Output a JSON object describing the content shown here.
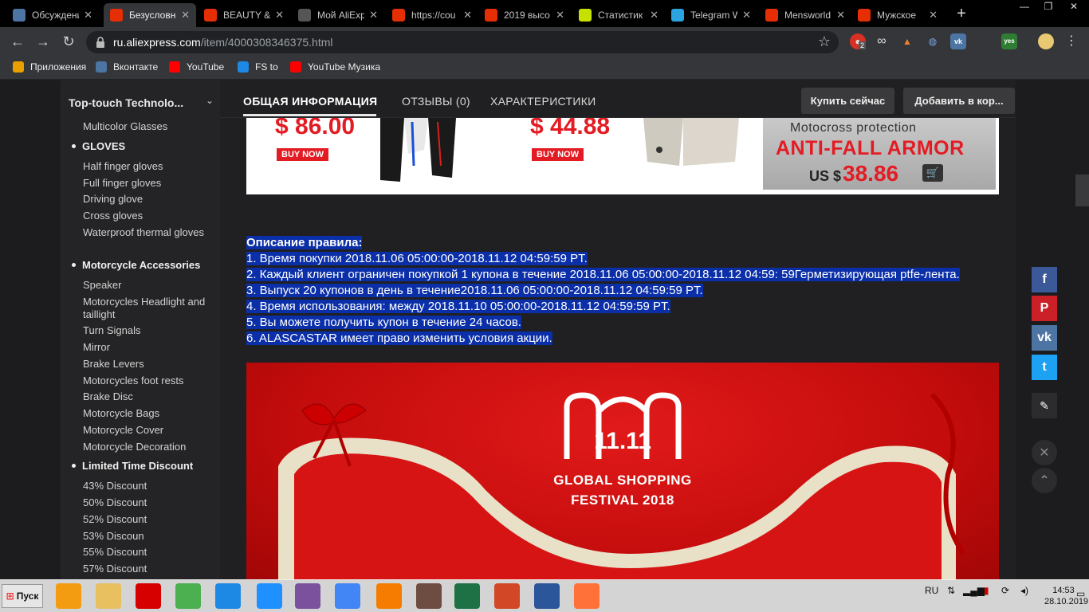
{
  "browser": {
    "tabs": [
      {
        "title": "Обсуждения",
        "icon": "vk-icon",
        "color": "#4c75a3"
      },
      {
        "title": "Безусловная",
        "icon": "aliexpress-icon",
        "color": "#e62e04",
        "active": true
      },
      {
        "title": "BEAUTY &",
        "icon": "aliexpress-icon",
        "color": "#e62e04"
      },
      {
        "title": "Мой AliExpress",
        "icon": "globe-icon",
        "color": "#555"
      },
      {
        "title": "https://cou",
        "icon": "aliexpress-icon",
        "color": "#e62e04"
      },
      {
        "title": "2019 высо",
        "icon": "aliexpress-icon",
        "color": "#e62e04"
      },
      {
        "title": "Статистик",
        "icon": "stats-icon",
        "color": "#c6e000"
      },
      {
        "title": "Telegram W",
        "icon": "telegram-icon",
        "color": "#2aa3e0"
      },
      {
        "title": "Mensworld",
        "icon": "aliexpress-icon",
        "color": "#e62e04"
      },
      {
        "title": "Мужское",
        "icon": "aliexpress-icon",
        "color": "#e62e04"
      }
    ],
    "url_host": "ru.aliexpress.com",
    "url_path": "/item/4000308346375.html",
    "ext_badge": "2",
    "ext_yes": "yes",
    "bookmarks": [
      {
        "label": "Приложения",
        "icon": "apps-icon",
        "color": "#e8a000"
      },
      {
        "label": "Вконтакте",
        "icon": "vk-icon",
        "color": "#4c75a3"
      },
      {
        "label": "YouTube",
        "icon": "youtube-icon",
        "color": "#ff0000"
      },
      {
        "label": "FS to",
        "icon": "fs-icon",
        "color": "#1e88e5"
      },
      {
        "label": "YouTube Музика",
        "icon": "youtube-music-icon",
        "color": "#ff0000"
      }
    ]
  },
  "sidebar": {
    "store_name": "Top-touch Technolo...",
    "items": [
      {
        "type": "item",
        "label": "Multicolor Glasses"
      },
      {
        "type": "cat",
        "label": "GLOVES"
      },
      {
        "type": "item",
        "label": "Half finger gloves"
      },
      {
        "type": "item",
        "label": "Full finger gloves"
      },
      {
        "type": "item",
        "label": "Driving glove"
      },
      {
        "type": "item",
        "label": "Cross gloves"
      },
      {
        "type": "item",
        "label": "Waterproof thermal gloves"
      },
      {
        "type": "cat",
        "label": "Motorcycle Accessories"
      },
      {
        "type": "item",
        "label": "Speaker"
      },
      {
        "type": "item",
        "label": "Motorcycles Headlight and taillight"
      },
      {
        "type": "item",
        "label": "Turn Signals"
      },
      {
        "type": "item",
        "label": "Mirror"
      },
      {
        "type": "item",
        "label": "Brake Levers"
      },
      {
        "type": "item",
        "label": "Motorcycles foot rests"
      },
      {
        "type": "item",
        "label": "Brake Disc"
      },
      {
        "type": "item",
        "label": "Motorcycle Bags"
      },
      {
        "type": "item",
        "label": "Motorcycle Cover"
      },
      {
        "type": "item",
        "label": "Motorcycle Decoration"
      },
      {
        "type": "cat",
        "label": "Limited Time Discount"
      },
      {
        "type": "item",
        "label": "43% Discount"
      },
      {
        "type": "item",
        "label": "50% Discount"
      },
      {
        "type": "item",
        "label": "52% Discount"
      },
      {
        "type": "item",
        "label": "53% Discoun"
      },
      {
        "type": "item",
        "label": "55% Discount"
      },
      {
        "type": "item",
        "label": "57% Discount"
      }
    ]
  },
  "product_tabs": {
    "overview": "ОБЩАЯ ИНФОРМАЦИЯ",
    "reviews": "ОТЗЫВЫ (0)",
    "specs": "ХАРАКТЕРИСТИКИ",
    "buy_now": "Купить сейчас",
    "add_to_cart": "Добавить в кор..."
  },
  "banner": {
    "price1": "$ 86.00",
    "price2": "$ 44.88",
    "buy_now": "BUY NOW",
    "protection_label": "Motocross protection",
    "armor_label": "ANTI-FALL ARMOR",
    "armor_price_prefix": "US $",
    "armor_price": "38.86"
  },
  "rules": {
    "title": "Описание правила:",
    "lines": [
      "1. Время покупки 2018.11.06 05:00:00-2018.11.12 04:59:59 PT.",
      "2. Каждый клиент ограничен покупкой 1 купона в течение 2018.11.06 05:00:00-2018.11.12 04:59: 59Герметизирующая ptfe-лента.",
      "3. Выпуск 20 купонов в день в течение2018.11.06 05:00:00-2018.11.12 04:59:59 PT.",
      "4. Время использования: между 2018.11.10 05:00:00-2018.11.12 04:59:59 PT.",
      "5. Вы можете получить купон в течение 24 часов.",
      "6. ALASCASTAR имеет право изменить условия акции."
    ]
  },
  "promo": {
    "logo_text": "11.11",
    "line1": "GLOBAL SHOPPING",
    "line2": "FESTIVAL 2018"
  },
  "share": [
    {
      "icon": "facebook-icon",
      "glyph": "f",
      "color": "#3b5998"
    },
    {
      "icon": "pinterest-icon",
      "glyph": "P",
      "color": "#cb2027"
    },
    {
      "icon": "vk-icon",
      "glyph": "vk",
      "color": "#4c75a3"
    },
    {
      "icon": "twitter-icon",
      "glyph": "t",
      "color": "#1da1f2"
    }
  ],
  "taskbar": {
    "start": "Пуск",
    "apps": [
      {
        "icon": "media-player-icon",
        "color": "#f39c12"
      },
      {
        "icon": "explorer-icon",
        "color": "#e8c060"
      },
      {
        "icon": "opera-icon",
        "color": "#d60000"
      },
      {
        "icon": "utorrent-icon",
        "color": "#4caf50"
      },
      {
        "icon": "paper-plane-icon",
        "color": "#1e88e5"
      },
      {
        "icon": "internet-explorer-icon",
        "color": "#1e90ff"
      },
      {
        "icon": "viber-icon",
        "color": "#7b519d"
      },
      {
        "icon": "chrome-icon",
        "color": "#4285f4"
      },
      {
        "icon": "ccleaner-icon",
        "color": "#f57c00"
      },
      {
        "icon": "game-icon",
        "color": "#6d4c41"
      },
      {
        "icon": "excel-icon",
        "color": "#1e7145"
      },
      {
        "icon": "powerpoint-icon",
        "color": "#d24726"
      },
      {
        "icon": "word-icon",
        "color": "#2b579a"
      },
      {
        "icon": "firefox-icon",
        "color": "#ff7139"
      }
    ],
    "lang": "RU",
    "time": "14:53",
    "date": "28.10.2019"
  }
}
